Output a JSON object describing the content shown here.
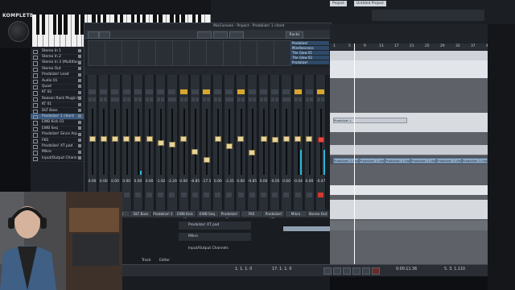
{
  "keyboard": {
    "brand": "KOMPLETE"
  },
  "tracklist": {
    "items": [
      {
        "label": "Stereo In 1",
        "selected": false
      },
      {
        "label": "Stereo In 2",
        "selected": false
      },
      {
        "label": "Stereo In 3 (Multiface)",
        "selected": false
      },
      {
        "label": "Stereo Out",
        "selected": false
      },
      {
        "label": "Prodalize! Lead",
        "selected": false
      },
      {
        "label": "Audio 01",
        "selected": false
      },
      {
        "label": "Quad",
        "selected": false
      },
      {
        "label": "KT 02",
        "selected": false
      },
      {
        "label": "Reason Rack Plugin 01",
        "selected": false
      },
      {
        "label": "KT 01",
        "selected": false
      },
      {
        "label": "DLT Bass",
        "selected": false
      },
      {
        "label": "Prodalize! 1 chord",
        "selected": true
      },
      {
        "label": "EWB Kick 01",
        "selected": false
      },
      {
        "label": "EWB Seq",
        "selected": false
      },
      {
        "label": "Prodalize! Since Arp",
        "selected": false
      },
      {
        "label": "FKS",
        "selected": false
      },
      {
        "label": "Prodalize! XT pad",
        "selected": false
      },
      {
        "label": "Mikro",
        "selected": false
      },
      {
        "label": "Input/Output Chann",
        "selected": false
      }
    ]
  },
  "mixer": {
    "title": "MixConsole - Project - Prodalize! 1 chord",
    "toolbar": [
      "",
      "",
      "",
      "",
      "",
      "Racks"
    ],
    "rack_slots": [
      "Prodalize!",
      "Mindlessness",
      "The Glow 01",
      "The Glow 02",
      "Prodalize!"
    ],
    "strips": [
      {
        "value": "0.00",
        "fader": 0.55,
        "meter": 0,
        "eq": false,
        "red": false
      },
      {
        "value": "0.00",
        "fader": 0.55,
        "meter": 0,
        "eq": false,
        "red": false
      },
      {
        "value": "0.00",
        "fader": 0.55,
        "meter": 0,
        "eq": false,
        "red": false
      },
      {
        "value": "0.00",
        "fader": 0.55,
        "meter": 0,
        "eq": false,
        "red": false
      },
      {
        "value": "0.00",
        "fader": 0.55,
        "meter": 0.06,
        "eq": false,
        "red": false
      },
      {
        "value": "0.00",
        "fader": 0.55,
        "meter": 0,
        "eq": false,
        "red": false
      },
      {
        "value": "-1.92",
        "fader": 0.48,
        "meter": 0,
        "eq": false,
        "red": false
      },
      {
        "value": "-2.29",
        "fader": 0.46,
        "meter": 0,
        "eq": false,
        "red": false
      },
      {
        "value": "0.00",
        "fader": 0.55,
        "meter": 0,
        "eq": true,
        "red": false
      },
      {
        "value": "-8.85",
        "fader": 0.34,
        "meter": 0,
        "eq": false,
        "red": false
      },
      {
        "value": "-17.5",
        "fader": 0.2,
        "meter": 0,
        "eq": true,
        "red": false
      },
      {
        "value": "0.00",
        "fader": 0.55,
        "meter": 0,
        "eq": false,
        "red": false
      },
      {
        "value": "-3.35",
        "fader": 0.43,
        "meter": 0,
        "eq": false,
        "red": false
      },
      {
        "value": "0.00",
        "fader": 0.55,
        "meter": 0,
        "eq": true,
        "red": false
      },
      {
        "value": "-9.85",
        "fader": 0.32,
        "meter": 0,
        "eq": false,
        "red": false
      },
      {
        "value": "0.00",
        "fader": 0.55,
        "meter": 0,
        "eq": false,
        "red": false
      },
      {
        "value": "-0.05",
        "fader": 0.54,
        "meter": 0,
        "eq": false,
        "red": false
      },
      {
        "value": "0.00",
        "fader": 0.55,
        "meter": 0,
        "eq": false,
        "red": false
      },
      {
        "value": "-0.04",
        "fader": 0.55,
        "meter": 0.38,
        "eq": true,
        "red": false
      },
      {
        "value": "0.00",
        "fader": 0.55,
        "meter": 0,
        "eq": false,
        "red": false
      },
      {
        "value": "-0.47",
        "fader": 0.54,
        "meter": 0.38,
        "eq": true,
        "red": true
      }
    ],
    "bottom_tabs": [
      "Reason Rack P",
      "KT 01",
      "DLT Bass",
      "Prodalize! 1 c",
      "EWB Kick 01",
      "EWB Seq",
      "Prodalize! Sinu",
      "FKS",
      "Prodalize! XT p",
      "Mikro",
      "Stereo Out"
    ]
  },
  "header": {
    "tabs": [
      "Project",
      "Untitled Project"
    ]
  },
  "arrange": {
    "ruler": [
      "1",
      "5",
      "9",
      "13",
      "17",
      "21",
      "25",
      "29",
      "33",
      "37",
      "41"
    ],
    "clips": [
      "Prodalize! 1 chord",
      "Prodalize! 1 chord",
      "Prodalize! 1 chord",
      "Prodalize! 1 chord",
      "Prodalize! 1 chord",
      "Prodalize! 1 chord"
    ],
    "clip_label_top": "Prodalize! L"
  },
  "lower": {
    "tracks": [
      "Prodalize! XT pad",
      "Mikro",
      "Input/Output Channels"
    ],
    "tabs": [
      "Track",
      "Editor"
    ]
  },
  "transport": {
    "left_pos": "1. 1. 1. 0",
    "right_pos": "17. 1. 1. 0",
    "time_display": "0:00:11.36",
    "bars_display": "5. 3. 1.110"
  }
}
